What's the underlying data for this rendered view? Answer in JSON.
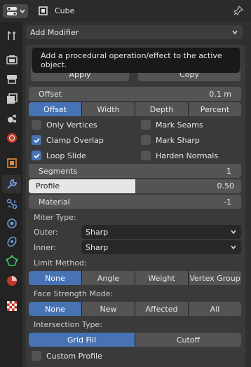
{
  "header": {
    "object_name": "Cube",
    "pin_icon": "pin-icon",
    "editor_icon": "properties-editor-icon",
    "object_icon": "object-icon"
  },
  "sidebar": {
    "tabs": [
      {
        "name": "tool-tab",
        "icon": "tool-icon"
      },
      {
        "name": "render-tab",
        "icon": "render-icon"
      },
      {
        "name": "output-tab",
        "icon": "output-icon"
      },
      {
        "name": "view-layer-tab",
        "icon": "view-layer-icon"
      },
      {
        "name": "scene-tab",
        "icon": "scene-icon"
      },
      {
        "name": "world-tab",
        "icon": "world-icon"
      },
      {
        "name": "object-tab",
        "icon": "object-icon"
      },
      {
        "name": "modifier-tab",
        "icon": "wrench-icon",
        "active": true
      },
      {
        "name": "particles-tab",
        "icon": "particles-icon"
      },
      {
        "name": "physics-tab",
        "icon": "physics-icon"
      },
      {
        "name": "constraints-tab",
        "icon": "constraints-icon"
      },
      {
        "name": "data-tab",
        "icon": "mesh-data-icon"
      },
      {
        "name": "material-tab",
        "icon": "material-icon"
      },
      {
        "name": "texture-tab",
        "icon": "texture-icon"
      }
    ]
  },
  "modifier": {
    "add_modifier": "Add Modifier",
    "tooltip": "Add a procedural operation/effect to the active object.",
    "apply": "Apply",
    "copy": "Copy",
    "offset_label": "Offset",
    "offset_value": "0.1 m",
    "offset_types": [
      "Offset",
      "Width",
      "Depth",
      "Percent"
    ],
    "offset_selected": 0,
    "checks_left": [
      {
        "label": "Only Vertices",
        "checked": false
      },
      {
        "label": "Clamp Overlap",
        "checked": true
      },
      {
        "label": "Loop Slide",
        "checked": true
      }
    ],
    "checks_right": [
      {
        "label": "Mark Seams",
        "checked": false
      },
      {
        "label": "Mark Sharp",
        "checked": false
      },
      {
        "label": "Harden Normals",
        "checked": false
      }
    ],
    "segments_label": "Segments",
    "segments_value": "1",
    "profile_label": "Profile",
    "profile_value": "0.50",
    "profile_fraction": 0.5,
    "material_label": "Material",
    "material_value": "-1",
    "miter_type_label": "Miter Type:",
    "outer_label": "Outer:",
    "outer_value": "Sharp",
    "inner_label": "Inner:",
    "inner_value": "Sharp",
    "limit_method_label": "Limit Method:",
    "limit_methods": [
      "None",
      "Angle",
      "Weight",
      "Vertex Group"
    ],
    "limit_selected": 0,
    "face_strength_label": "Face Strength Mode:",
    "face_strength": [
      "None",
      "New",
      "Affected",
      "All"
    ],
    "face_selected": 0,
    "intersection_label": "Intersection Type:",
    "intersection": [
      "Grid Fill",
      "Cutoff"
    ],
    "intersection_selected": 0,
    "custom_profile_label": "Custom Profile",
    "custom_profile_checked": false
  },
  "colors": {
    "accent": "#4772b3",
    "background": "#303030",
    "widget": "#545454"
  }
}
